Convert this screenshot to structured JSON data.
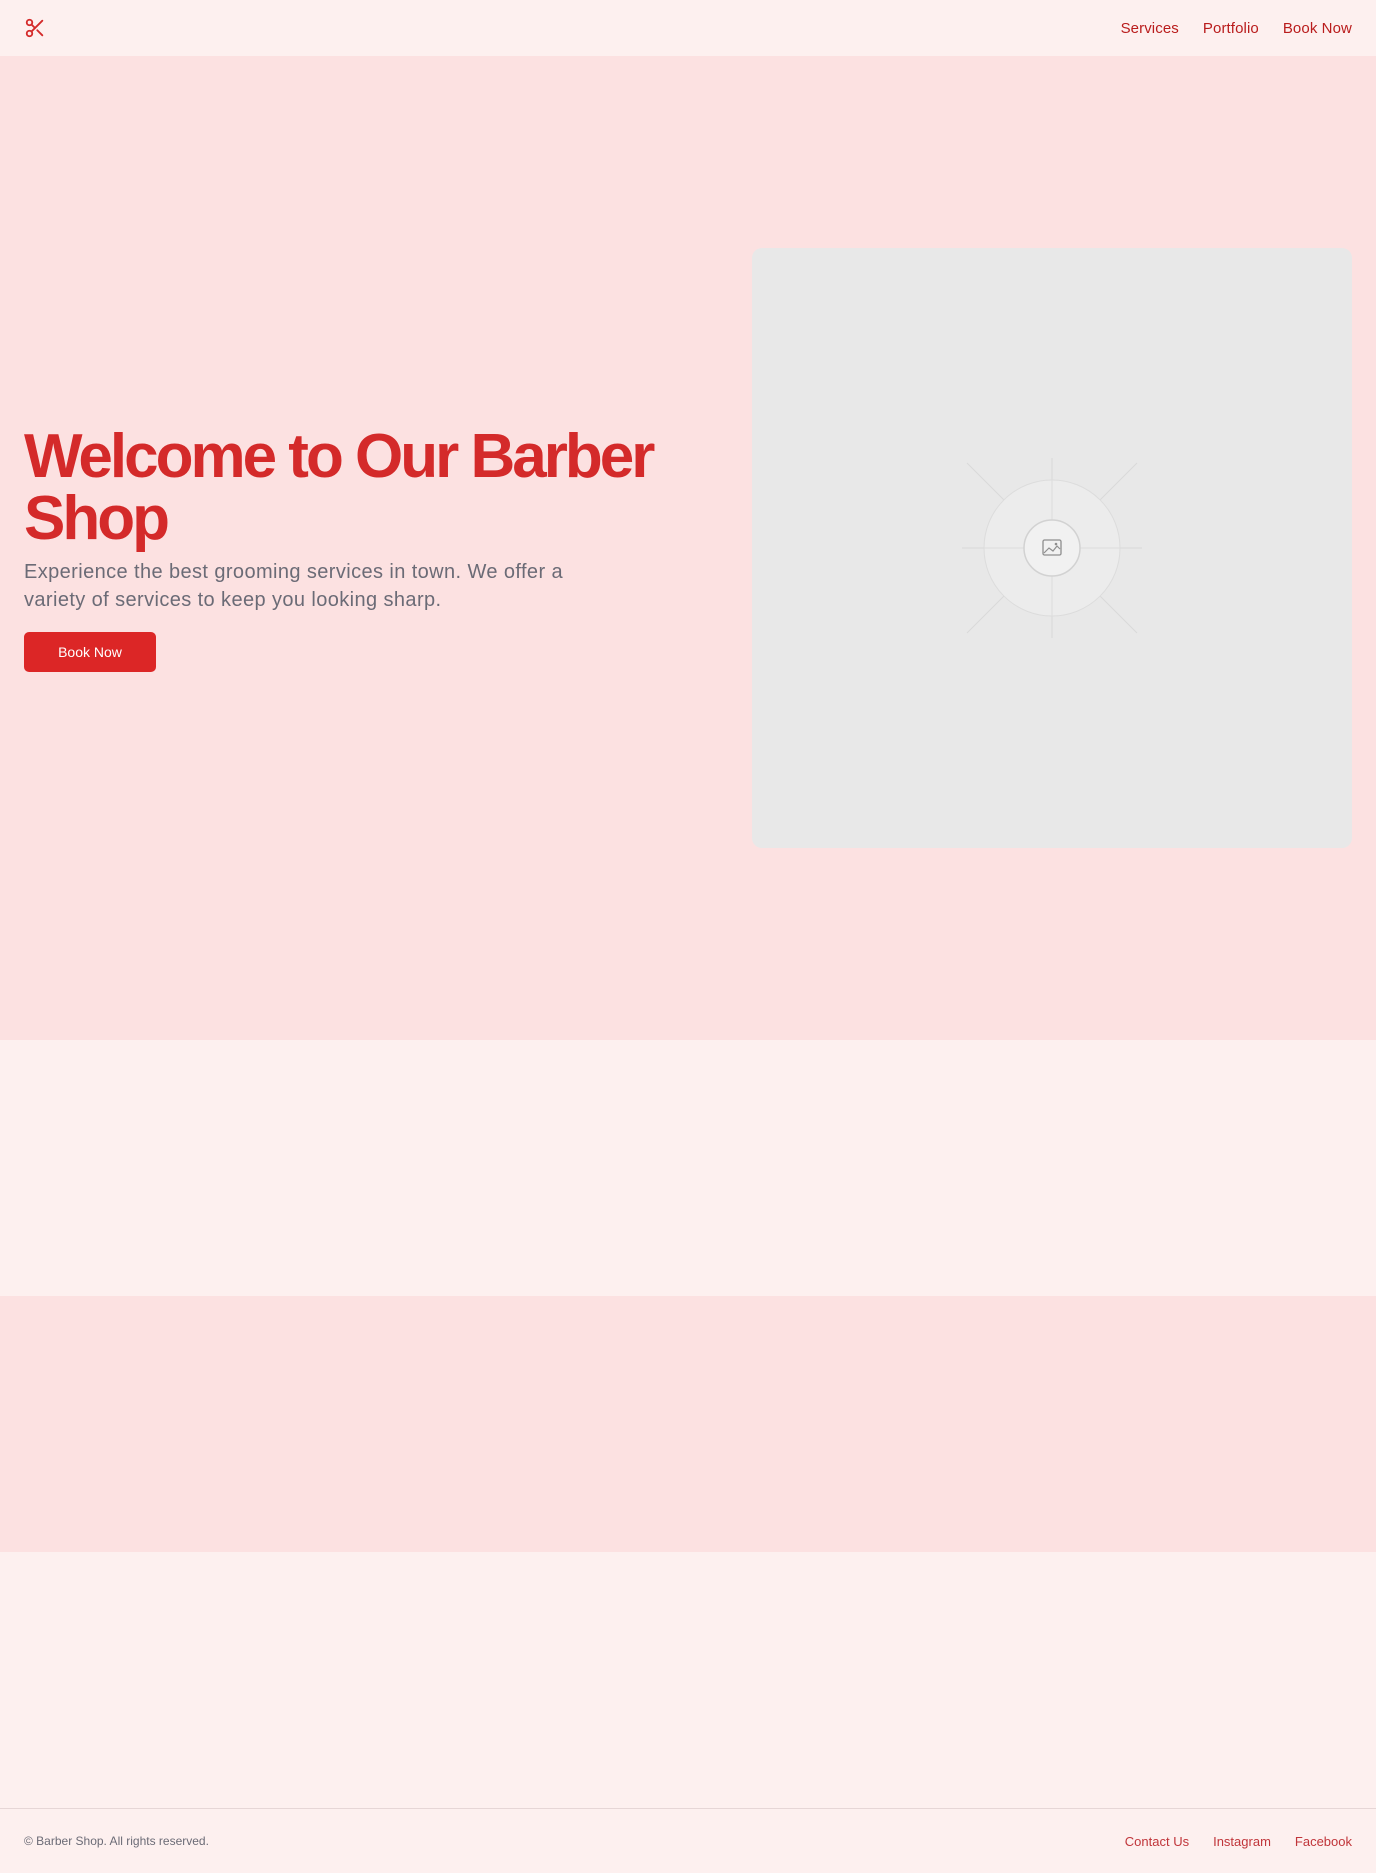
{
  "header": {
    "logo_icon": "scissors-icon",
    "nav": [
      {
        "label": "Services"
      },
      {
        "label": "Portfolio"
      },
      {
        "label": "Book Now"
      }
    ]
  },
  "hero": {
    "title": "Welcome to Our Barber Shop",
    "subtitle": "Experience the best grooming services in town. We offer a variety of services to keep you looking sharp.",
    "cta_label": "Book Now",
    "image_icon": "image-placeholder-icon"
  },
  "footer": {
    "copyright": "© Barber Shop. All rights reserved.",
    "links": [
      {
        "label": "Contact Us"
      },
      {
        "label": "Instagram"
      },
      {
        "label": "Facebook"
      }
    ]
  },
  "colors": {
    "accent": "#dc2626",
    "accent_text": "#b91c1c",
    "hero_background": "#fce1e1",
    "page_background": "#fdf0ef",
    "muted_text": "#6b6b76",
    "placeholder_background": "#e8e8e8"
  }
}
